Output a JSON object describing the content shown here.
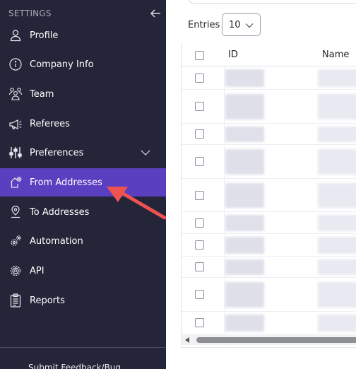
{
  "sidebar": {
    "title": "SETTINGS",
    "items": [
      {
        "label": "Profile",
        "icon": "user-icon"
      },
      {
        "label": "Company Info",
        "icon": "info-icon"
      },
      {
        "label": "Team",
        "icon": "team-icon"
      },
      {
        "label": "Referees",
        "icon": "megaphone-icon"
      },
      {
        "label": "Preferences",
        "icon": "sliders-icon"
      },
      {
        "label": "From Addresses",
        "icon": "home-pin-icon"
      },
      {
        "label": "To Addresses",
        "icon": "map-pin-icon"
      },
      {
        "label": "Automation",
        "icon": "gears-icon"
      },
      {
        "label": "API",
        "icon": "api-gear-icon"
      },
      {
        "label": "Reports",
        "icon": "clipboard-icon"
      }
    ],
    "active_item": "From Addresses",
    "feedback_label": "Submit Feedback/Bug"
  },
  "main": {
    "entries_label": "Entries",
    "entries_value": "10",
    "table": {
      "columns": [
        "ID",
        "Name"
      ]
    }
  },
  "colors": {
    "sidebar_bg": "#242538",
    "active_bg": "#5a3fc0",
    "annotation_arrow": "#ef5350"
  }
}
